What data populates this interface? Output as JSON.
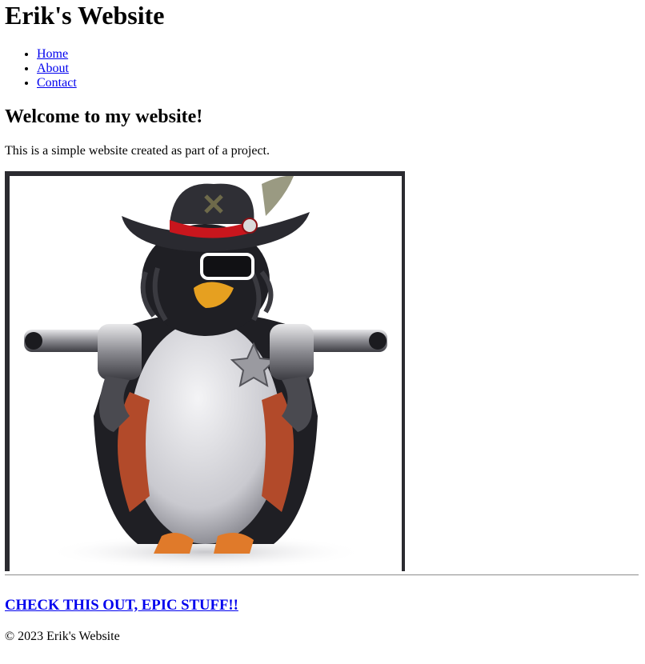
{
  "site": {
    "title": "Erik's Website"
  },
  "nav": {
    "items": [
      {
        "label": "Home"
      },
      {
        "label": "About"
      },
      {
        "label": "Contact"
      }
    ]
  },
  "main": {
    "heading": "Welcome to my website!",
    "intro": "This is a simple website created as part of a project.",
    "image_subject": "cowboy penguin holding two revolvers"
  },
  "cta": {
    "label": "CHECK THIS OUT, EPIC STUFF!!"
  },
  "footer": {
    "text": "© 2023 Erik's Website"
  },
  "colors": {
    "link": "#0000ee",
    "text": "#000000",
    "frame": "#2b2b30"
  }
}
